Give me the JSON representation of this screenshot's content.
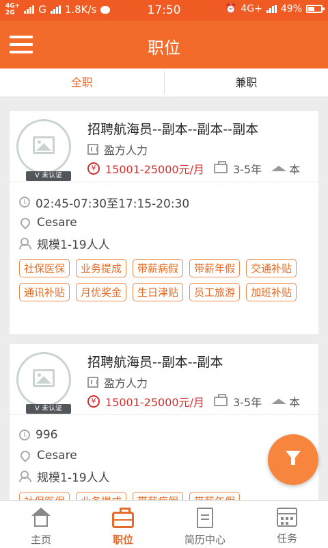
{
  "status_bar": {
    "net1": "4G+",
    "net2": "2G",
    "carrier": "G",
    "speed": "1.8K/s",
    "time": "17:50",
    "net_right": "4G+",
    "battery": "49%"
  },
  "header": {
    "title": "职位"
  },
  "tabs": [
    {
      "label": "全职",
      "active": true
    },
    {
      "label": "兼职",
      "active": false
    }
  ],
  "cards": [
    {
      "badge": "未认证",
      "title": "招聘航海员--副本--副本--副本",
      "company": "盈方人力",
      "salary": "15001-25000元/月",
      "experience": "3-5年",
      "education": "本",
      "time": "02:45-07:30至17:15-20:30",
      "location": "Cesare",
      "size": "规模1-19人人",
      "tags": [
        "社保医保",
        "业务提成",
        "带薪病假",
        "带薪年假",
        "交通补贴",
        "通讯补贴",
        "月优奖金",
        "生日津贴",
        "员工旅游",
        "加班补贴"
      ]
    },
    {
      "badge": "未认证",
      "title": "招聘航海员--副本--副本",
      "company": "盈方人力",
      "salary": "15001-25000元/月",
      "experience": "3-5年",
      "education": "本",
      "time": "996",
      "location": "Cesare",
      "size": "规模1-19人人",
      "tags": [
        "社保医保",
        "业务提成",
        "带薪病假",
        "带薪年假"
      ]
    }
  ],
  "bottom_nav": [
    {
      "label": "主页",
      "icon": "home-icon",
      "active": false
    },
    {
      "label": "职位",
      "icon": "briefcase-icon",
      "active": true
    },
    {
      "label": "简历中心",
      "icon": "resume-icon",
      "active": false
    },
    {
      "label": "任务",
      "icon": "calendar-icon",
      "active": false
    }
  ],
  "colors": {
    "brand": "#f26b2b",
    "salary": "#d32f2f",
    "tag": "#e86b23"
  }
}
